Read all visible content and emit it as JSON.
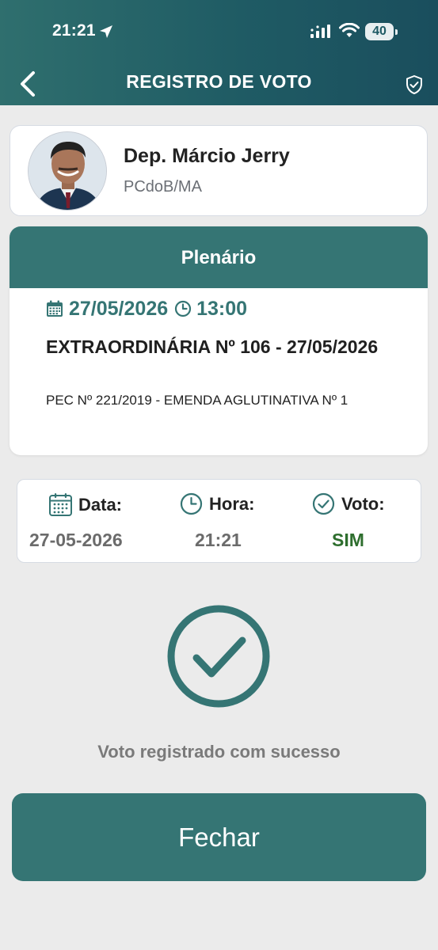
{
  "status_bar": {
    "time": "21:21",
    "battery": "40"
  },
  "header": {
    "title": "REGISTRO DE VOTO"
  },
  "profile": {
    "name": "Dep. Márcio Jerry",
    "party": "PCdoB/MA"
  },
  "session": {
    "header": "Plenário",
    "date": "27/05/2026",
    "time": "13:00",
    "title": "EXTRAORDINÁRIA Nº 106 - 27/05/2026",
    "description": "PEC Nº 221/2019 - EMENDA AGLUTINATIVA Nº 1"
  },
  "vote_info": {
    "date_label": "Data:",
    "date_value": "27-05-2026",
    "time_label": "Hora:",
    "time_value": "21:21",
    "vote_label": "Voto:",
    "vote_value": "SIM",
    "vote_color": "#2e6e2e"
  },
  "result": {
    "message": "Voto registrado com sucesso"
  },
  "actions": {
    "close_label": "Fechar"
  },
  "colors": {
    "primary": "#357574",
    "header_gradient_start": "#2f6f6e",
    "header_gradient_end": "#1a4e5d",
    "background": "#ebebeb"
  }
}
